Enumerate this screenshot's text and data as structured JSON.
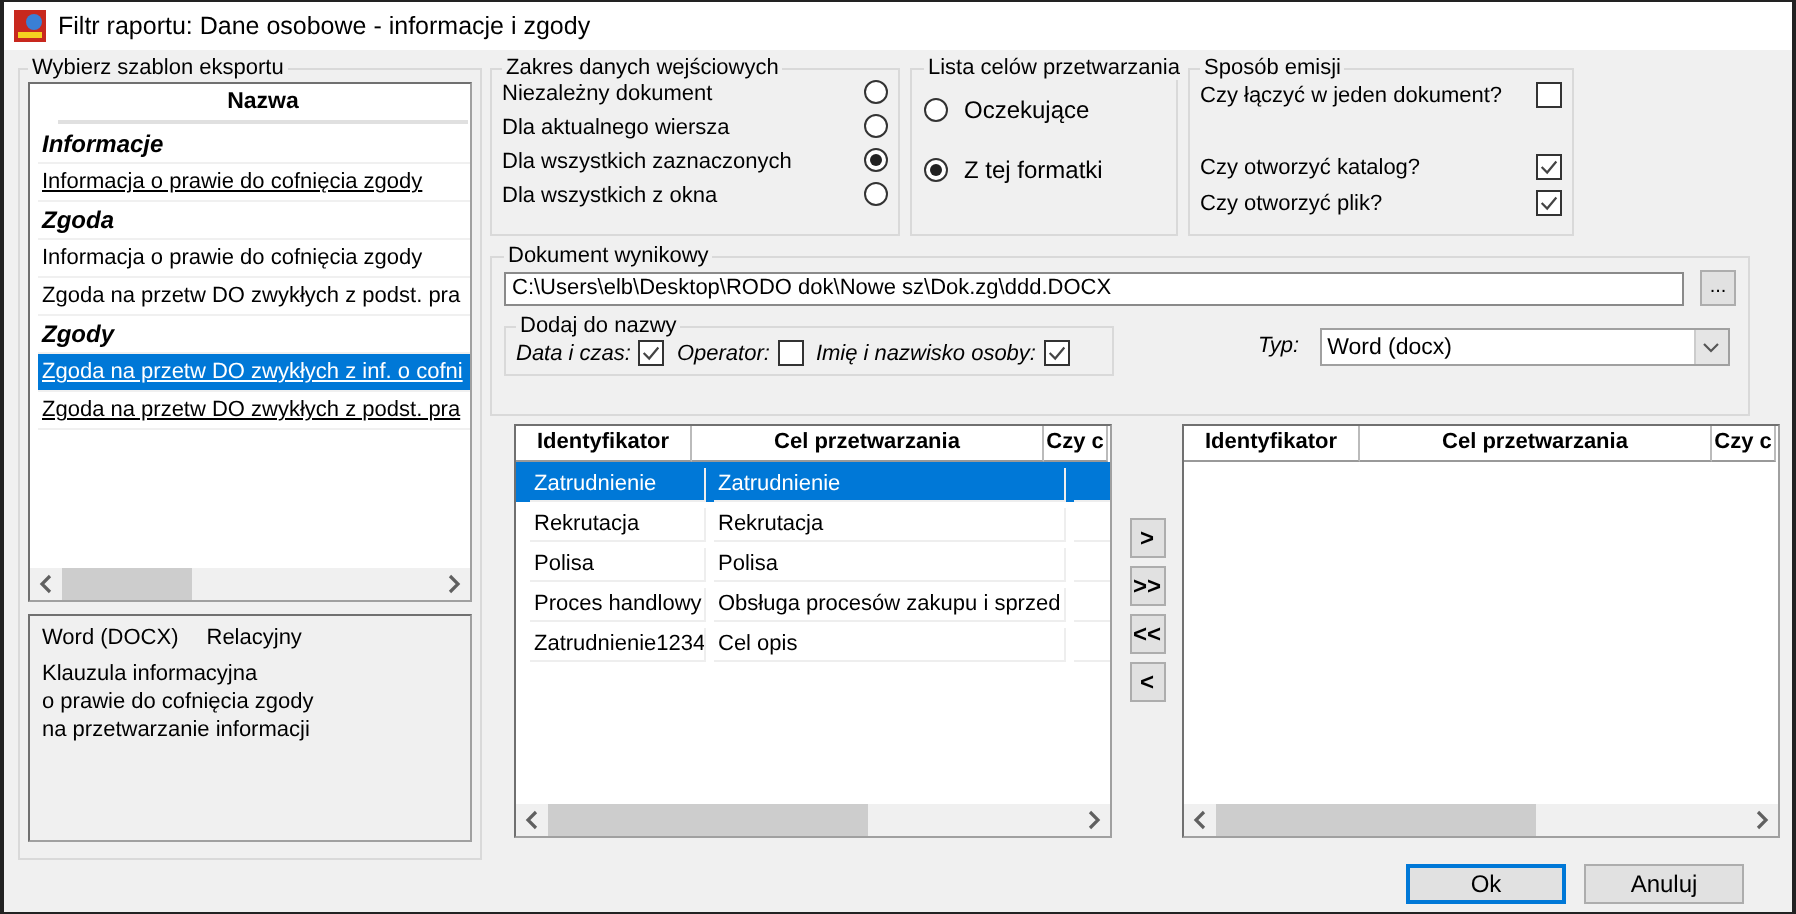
{
  "window": {
    "title": "Filtr raportu: Dane osobowe - informacje i zgody"
  },
  "template_group": {
    "title": "Wybierz szablon eksportu",
    "column": "Nazwa",
    "items": [
      {
        "label": "Informacje",
        "kind": "group",
        "selected": false
      },
      {
        "label": "Informacja o prawie do cofnięcia zgody",
        "kind": "link",
        "selected": false
      },
      {
        "label": "Zgoda",
        "kind": "group",
        "selected": false
      },
      {
        "label": "Informacja o prawie do cofnięcia zgody",
        "kind": "plain",
        "selected": false
      },
      {
        "label": "Zgoda na przetw DO zwykłych z podst. pra",
        "kind": "plain",
        "selected": false
      },
      {
        "label": "Zgody",
        "kind": "group",
        "selected": false
      },
      {
        "label": "Zgoda na przetw DO zwykłych z inf. o cofni",
        "kind": "link",
        "selected": true
      },
      {
        "label": "Zgoda na przetw DO zwykłych z podst. pra",
        "kind": "link",
        "selected": false
      }
    ]
  },
  "template_info": {
    "format": "Word  (DOCX)",
    "model": "Relacyjny",
    "lines": [
      "Klauzula informacyjna",
      "o prawie do cofnięcia zgody",
      "na przetwarzanie informacji"
    ]
  },
  "input_scope": {
    "title": "Zakres danych wejściowych",
    "options": [
      {
        "label": "Niezależny dokument",
        "selected": false
      },
      {
        "label": "Dla aktualnego wiersza",
        "selected": false
      },
      {
        "label": "Dla wszystkich zaznaczonych",
        "selected": true
      },
      {
        "label": "Dla wszystkich z okna",
        "selected": false
      }
    ]
  },
  "purpose_list": {
    "title": "Lista celów przetwarzania",
    "options": [
      {
        "label": "Oczekujące",
        "selected": false
      },
      {
        "label": "Z tej formatki",
        "selected": true
      }
    ]
  },
  "emission": {
    "title": "Sposób emisji",
    "options": [
      {
        "label": "Czy łączyć w jeden dokument?",
        "checked": false
      },
      {
        "label": "Czy otworzyć katalog?",
        "checked": true
      },
      {
        "label": "Czy otworzyć plik?",
        "checked": true
      }
    ]
  },
  "output_document": {
    "title": "Dokument wynikowy",
    "path": "C:\\Users\\elb\\Desktop\\RODO dok\\Nowe sz\\Dok.zg\\ddd.DOCX",
    "browse_button": "...",
    "add_to_name": {
      "title": "Dodaj do nazwy",
      "options": [
        {
          "label": "Data i czas:",
          "checked": true
        },
        {
          "label": "Operator:",
          "checked": false
        },
        {
          "label": "Imię i nazwisko osoby:",
          "checked": true
        }
      ]
    },
    "type_label": "Typ:",
    "type_value": "Word  (docx)"
  },
  "available_table": {
    "columns": [
      "Identyfikator",
      "Cel przetwarzania",
      "Czy c"
    ],
    "rows": [
      {
        "cells": [
          "Zatrudnienie",
          "Zatrudnienie"
        ],
        "selected": true
      },
      {
        "cells": [
          "Rekrutacja",
          "Rekrutacja"
        ],
        "selected": false
      },
      {
        "cells": [
          "Polisa",
          "Polisa"
        ],
        "selected": false
      },
      {
        "cells": [
          "Proces handlowy",
          "Obsługa procesów zakupu i sprzed"
        ],
        "selected": false
      },
      {
        "cells": [
          "Zatrudnienie1234",
          "Cel opis"
        ],
        "selected": false
      }
    ]
  },
  "move_buttons": [
    ">",
    ">>",
    "<<",
    "<"
  ],
  "selected_table": {
    "columns": [
      "Identyfikator",
      "Cel przetwarzania",
      "Czy c"
    ]
  },
  "buttons": [
    {
      "label": "Ok",
      "default": true
    },
    {
      "label": "Anuluj",
      "default": false
    }
  ]
}
